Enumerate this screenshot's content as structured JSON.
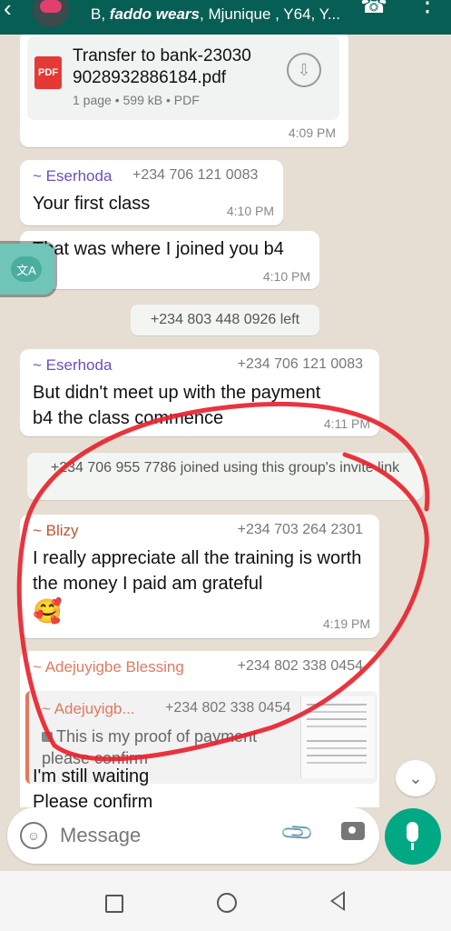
{
  "header": {
    "title_prefix": "B, ",
    "title_italic": "faddo wears",
    "title_rest": ", Mjunique , Y64, Y..."
  },
  "messages": {
    "pdf": {
      "filename": "Transfer to bank-23030\n9028932886184.pdf",
      "meta": "1 page • 599 kB • PDF",
      "icon_label": "PDF",
      "time": "4:09 PM"
    },
    "m1": {
      "sender": "~ Eserhoda",
      "phone": "+234 706 121 0083",
      "text": "Your first class",
      "time": "4:10 PM"
    },
    "m2": {
      "text": "That was where I joined you b4",
      "time": "4:10 PM"
    },
    "sys1": "+234 803 448 0926 left",
    "m3": {
      "sender": "~ Eserhoda",
      "phone": "+234 706 121 0083",
      "text": "But didn't meet up with the payment b4 the class commence",
      "time": "4:11 PM"
    },
    "sys2": "+234 706 955 7786 joined using this group's invite link",
    "m4": {
      "sender": "~ Blizy",
      "phone": "+234 703 264 2301",
      "text": "I really appreciate all the training is worth the money I paid am grateful",
      "emoji": "🥰",
      "time": "4:19 PM"
    },
    "m5": {
      "sender": "~ Adejuyigbe Blessing",
      "phone": "+234 802 338 0454",
      "quote_sender": "~ Adejuyigb...",
      "quote_phone": "+234 802 338 0454",
      "quote_text": "This is my proof of payment please confirm",
      "text": "I'm still waiting\nPlease confirm"
    }
  },
  "composer": {
    "placeholder": "Message"
  },
  "colors": {
    "header": "#075e54",
    "accent": "#00a884",
    "annotation": "#e8232e",
    "sender_eserhoda": "#6a4fbf",
    "sender_blizy": "#c0552e",
    "sender_adejuyigbe": "#e07a5f"
  },
  "icons": [
    "back-arrow-icon",
    "call-icon",
    "more-icon",
    "pdf-icon",
    "download-icon",
    "translate-icon",
    "image-icon",
    "scroll-down-icon",
    "emoji-icon",
    "attach-icon",
    "camera-icon",
    "mic-icon",
    "recents-icon",
    "home-icon",
    "back-icon"
  ]
}
